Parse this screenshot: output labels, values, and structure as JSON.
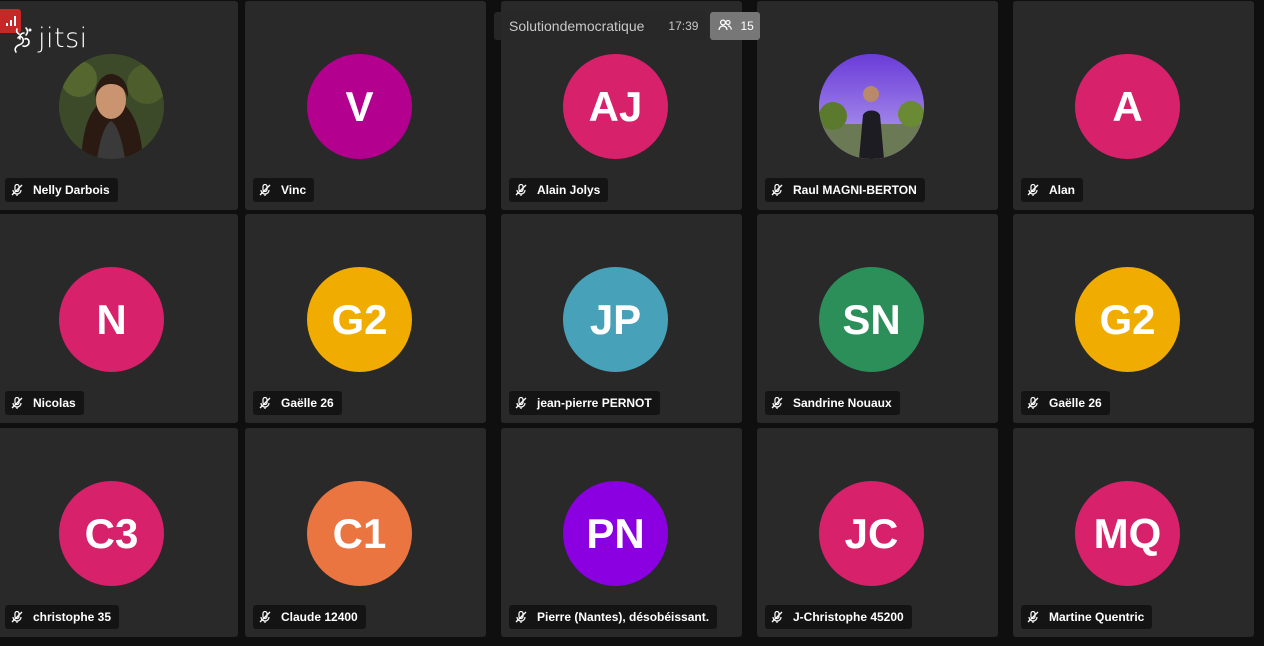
{
  "meeting": {
    "subject": "Solutiondemocratique",
    "time": "17:39",
    "participant_count": "15"
  },
  "brand": {
    "logo_text": "jitsi",
    "signal_color": "#c62828"
  },
  "participants": [
    {
      "name": "Nelly Darbois",
      "initials": "",
      "color": "#2f3a22",
      "has_photo": true,
      "muted": true
    },
    {
      "name": "Vinc",
      "initials": "V",
      "color": "#b4008e",
      "has_photo": false,
      "muted": true
    },
    {
      "name": "Alain Jolys",
      "initials": "AJ",
      "color": "#d8216b",
      "has_photo": false,
      "muted": true
    },
    {
      "name": "Raul MAGNI-BERTON",
      "initials": "",
      "color": "#5b4ec9",
      "has_photo": true,
      "muted": true
    },
    {
      "name": "Alan",
      "initials": "A",
      "color": "#d8216b",
      "has_photo": false,
      "muted": true
    },
    {
      "name": "Nicolas",
      "initials": "N",
      "color": "#d8216b",
      "has_photo": false,
      "muted": true
    },
    {
      "name": "Gaëlle 26",
      "initials": "G2",
      "color": "#f0ac00",
      "has_photo": false,
      "muted": true
    },
    {
      "name": "jean-pierre PERNOT",
      "initials": "JP",
      "color": "#47a2b9",
      "has_photo": false,
      "muted": true
    },
    {
      "name": "Sandrine Nouaux",
      "initials": "SN",
      "color": "#2c8f5a",
      "has_photo": false,
      "muted": true
    },
    {
      "name": "Gaëlle 26",
      "initials": "G2",
      "color": "#f0ac00",
      "has_photo": false,
      "muted": true
    },
    {
      "name": "christophe 35",
      "initials": "C3",
      "color": "#d8216b",
      "has_photo": false,
      "muted": true
    },
    {
      "name": "Claude 12400",
      "initials": "C1",
      "color": "#ea7540",
      "has_photo": false,
      "muted": true
    },
    {
      "name": "Pierre (Nantes), désobéissant.",
      "initials": "PN",
      "color": "#8a00e0",
      "has_photo": false,
      "muted": true
    },
    {
      "name": "J-Christophe 45200",
      "initials": "JC",
      "color": "#d8216b",
      "has_photo": false,
      "muted": true
    },
    {
      "name": "Martine Quentric",
      "initials": "MQ",
      "color": "#d8216b",
      "has_photo": false,
      "muted": true
    }
  ]
}
